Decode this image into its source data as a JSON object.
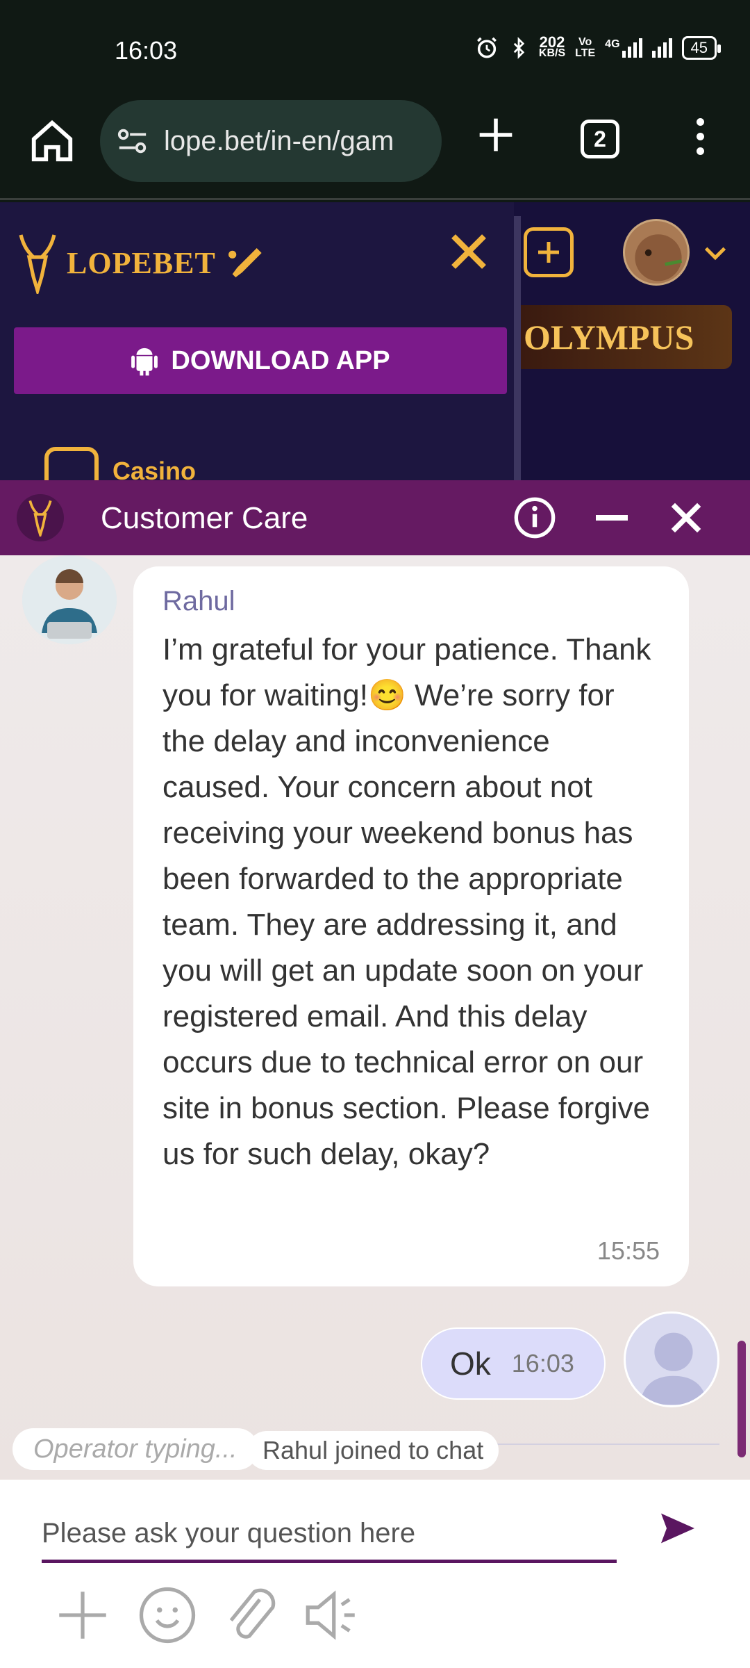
{
  "status_bar": {
    "time": "16:03",
    "net_speed": "202",
    "net_unit": "KB/S",
    "volte_top": "Vo",
    "volte_bottom": "LTE",
    "signal_label": "4G",
    "battery": "45"
  },
  "browser": {
    "url": "lope.bet/in-en/gam",
    "tab_count": "2"
  },
  "site": {
    "logo_text": "LOPEBET",
    "download_label": "DOWNLOAD APP",
    "menu_item_casino": "Casino",
    "banner_text": "OLYMPUS",
    "brand_gold": "#f1b33c",
    "brand_purple": "#7b1a8a"
  },
  "chat": {
    "header_title": "Customer Care",
    "header_color": "#651a62",
    "agent_name": "Rahul",
    "agent_message_part1": "I’m grateful for your patience. Thank you for waiting!",
    "agent_message_emoji": "😊",
    "agent_message_part2": " We’re sorry for the delay and inconvenience caused. Your concern about not receiving your weekend bonus has been forwarded to the appropriate team. They are addressing it, and you will get an update soon on your registered email. And this delay occurs due to technical error on our site in bonus section. Please forgive us for such delay, okay?",
    "agent_message_time": "15:55",
    "user_message": "Ok",
    "user_message_time": "16:03",
    "typing_status": "Operator typing...",
    "joined_status": "Rahul joined to chat",
    "input_placeholder": "Please ask your question here"
  },
  "icons": {
    "home": "home-icon",
    "site_settings": "tune-icon",
    "new_tab": "plus-icon",
    "menu": "more-vert-icon",
    "send": "send-icon",
    "attach": "paperclip-icon",
    "emoji": "smiley-icon",
    "add": "plus-icon",
    "sound": "speaker-icon"
  }
}
